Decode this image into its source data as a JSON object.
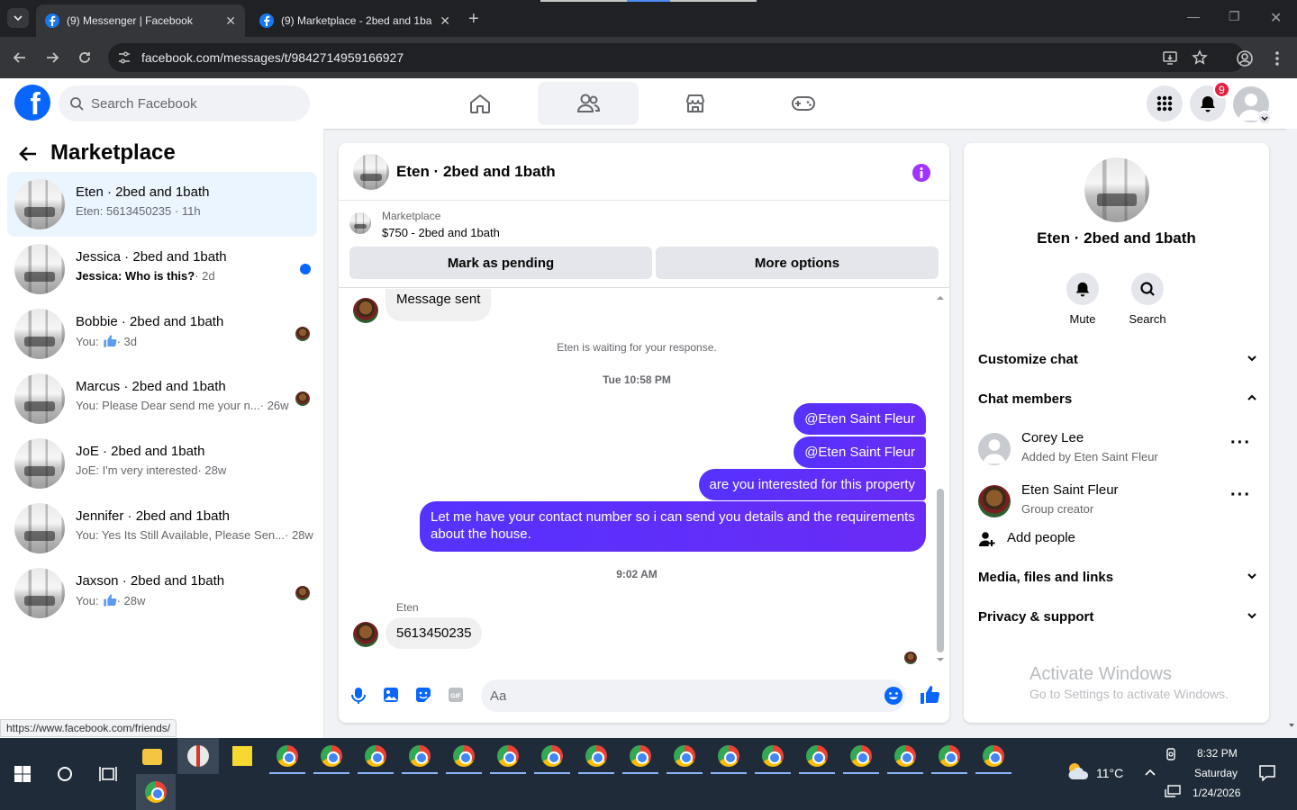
{
  "browser": {
    "tabs": [
      {
        "title": "(9) Messenger | Facebook",
        "active": true
      },
      {
        "title": "(9) Marketplace - 2bed and 1ba",
        "active": false
      }
    ],
    "url": "facebook.com/messages/t/9842714959166927"
  },
  "header": {
    "search_placeholder": "Search Facebook",
    "notification_count": "9"
  },
  "sidebar": {
    "title": "Marketplace",
    "conversations": [
      {
        "name": "Eten · 2bed and 1bath",
        "preview": "Eten: 5613450235 · 11h",
        "selected": true,
        "unread": false
      },
      {
        "name": "Jessica · 2bed and 1bath",
        "preview": "Jessica: Who is this?",
        "time": " · 2d",
        "unread": true
      },
      {
        "name": "Bobbie · 2bed and 1bath",
        "preview": "You:",
        "time": " · 3d",
        "like": true
      },
      {
        "name": "Marcus · 2bed and 1bath",
        "preview": "You: Please Dear send me your n...",
        "time": " · 26w"
      },
      {
        "name": "JoE · 2bed and 1bath",
        "preview": "JoE: I'm very interested",
        "time": " · 28w"
      },
      {
        "name": "Jennifer · 2bed and 1bath",
        "preview": "You: Yes Its Still Available, Please Sen...",
        "time": " · 28w"
      },
      {
        "name": "Jaxson · 2bed and 1bath",
        "preview": "You:",
        "time": " · 28w",
        "like": true
      }
    ]
  },
  "status_url": "https://www.facebook.com/friends/",
  "chat": {
    "title": "Eten · 2bed and 1bath",
    "listing_source": "Marketplace",
    "listing_title": "$750 - 2bed and 1bath",
    "mark_pending_label": "Mark as pending",
    "more_options_label": "More options",
    "messages": {
      "m1": "Message sent",
      "sys1": "Eten is waiting for your response.",
      "ts1": "Tue 10:58 PM",
      "o1": "@Eten Saint Fleur",
      "o2": "@Eten Saint Fleur",
      "o3": "are you interested for this property",
      "o4": "Let me have your contact number so i can send you details and the requirements about the house.",
      "ts2": "9:02 AM",
      "sender": "Eten",
      "m2": "5613450235"
    },
    "composer_placeholder": "Aa"
  },
  "details": {
    "name": "Eten · 2bed and 1bath",
    "mute_label": "Mute",
    "search_label": "Search",
    "customize_chat": "Customize chat",
    "chat_members": "Chat members",
    "members": [
      {
        "name": "Corey Lee",
        "role": "Added by Eten Saint Fleur"
      },
      {
        "name": "Eten Saint Fleur",
        "role": "Group creator"
      }
    ],
    "add_people": "Add people",
    "media": "Media, files and links",
    "privacy": "Privacy & support"
  },
  "watermark": {
    "line1": "Activate Windows",
    "line2": "Go to Settings to activate Windows."
  },
  "taskbar": {
    "weather": "11°C",
    "time": "8:32 PM",
    "day": "Saturday",
    "date": "1/24/2026"
  },
  "colors": {
    "fb_blue": "#0866ff",
    "outgoing_bubble": "#5632ff",
    "info_purple": "#a033ff"
  }
}
